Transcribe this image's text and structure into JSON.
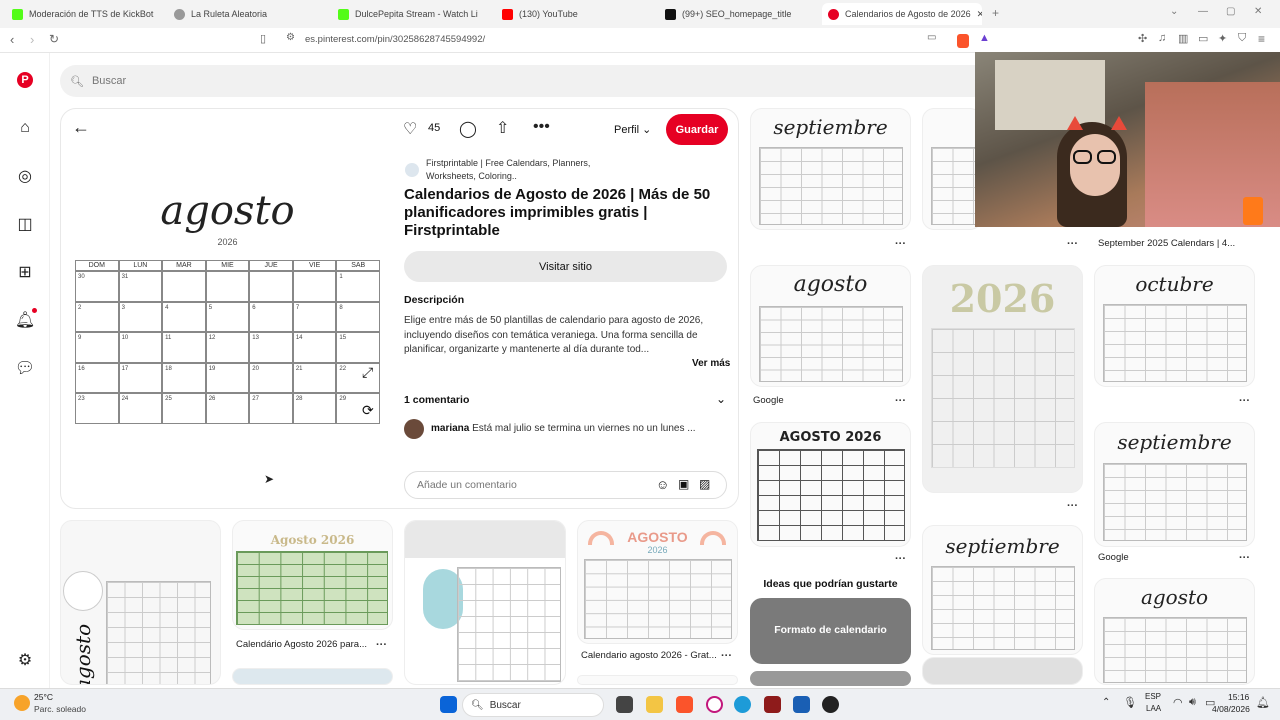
{
  "browser": {
    "tabs": [
      {
        "label": "Moderación de TTS de KickBot",
        "color": "#53fc18"
      },
      {
        "label": "La Ruleta Aleatoria",
        "color": "#888888"
      },
      {
        "label": "DulcePepita Stream - Watch Live",
        "color": "#53fc18"
      },
      {
        "label": "(130) YouTube",
        "color": "#ff0000"
      },
      {
        "label": "(99+) SEO_homepage_title",
        "color": "#111111"
      },
      {
        "label": "Calendarios de Agosto de 2026",
        "color": "#e60023"
      }
    ],
    "url": "es.pinterest.com/pin/30258628745594992/"
  },
  "search": {
    "placeholder": "Buscar"
  },
  "pin": {
    "like_count": "45",
    "profile_label": "Perfil",
    "save_label": "Guardar",
    "source": "Firstprintable | Free Calendars, Planners, Worksheets, Coloring..",
    "title": "Calendarios de Agosto de 2026 | Más de 50 planificadores imprimibles gratis | Firstprintable",
    "visit_label": "Visitar sitio",
    "description_heading": "Descripción",
    "description": "Elige entre más de 50 plantillas de calendario para agosto de 2026, incluyendo diseños con temática veraniega. Una forma sencilla de planificar, organizarte y mantenerte al día durante tod...",
    "see_more": "Ver más",
    "comments_heading": "1 comentario",
    "comment_user": "mariana",
    "comment_text": "Está mal julio se termina un viernes no un lunes ...",
    "comment_placeholder": "Añade un comentario"
  },
  "pin_image": {
    "month": "agosto",
    "year": "2026",
    "weekdays": [
      "DOM",
      "LUN",
      "MAR",
      "MIE",
      "JUE",
      "VIE",
      "SAB"
    ],
    "days": [
      "30",
      "31",
      "",
      "",
      "",
      "",
      "1",
      "2",
      "3",
      "4",
      "5",
      "6",
      "7",
      "8",
      "9",
      "10",
      "11",
      "12",
      "13",
      "14",
      "15",
      "16",
      "17",
      "18",
      "19",
      "20",
      "21",
      "22",
      "23",
      "24",
      "25",
      "26",
      "27",
      "28",
      "29"
    ]
  },
  "feed": {
    "captions": {
      "google1": "Google",
      "sept2025": "September 2025 Calendars | 4...",
      "google2": "Google",
      "cal_agosto_para": "Calendário Agosto 2026 para...",
      "cal_agosto_grat": "Calendario agosto 2026 - Grat...",
      "ideas": "Ideas que podrían gustarte",
      "formato": "Formato de calendario"
    },
    "thumb_titles": {
      "septiembre": "septiembre",
      "agosto": "agosto",
      "octubre": "octubre",
      "agosto_block": "AGOSTO 2026",
      "big2026": "2026",
      "green": "Agosto 2026",
      "rainbow": "AGOSTO",
      "rainbow_year": "2026"
    }
  },
  "taskbar": {
    "weather_temp": "25°C",
    "weather_desc": "Parc. soleado",
    "search_label": "Buscar",
    "lang": "ESP",
    "lang2": "LAA",
    "time": "15:16",
    "date": "4/08/2026"
  }
}
